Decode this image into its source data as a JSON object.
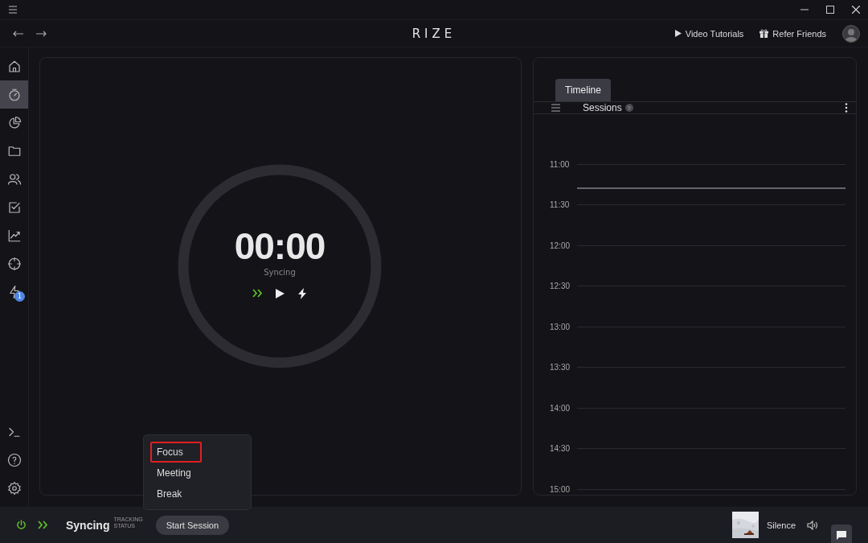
{
  "app": {
    "title": "RIZE"
  },
  "header_links": [
    {
      "kind": "play",
      "label": "Video Tutorials"
    },
    {
      "kind": "gift",
      "label": "Refer Friends"
    }
  ],
  "sidebar": {
    "items": [
      {
        "kind": "home",
        "selected": false
      },
      {
        "kind": "timer",
        "selected": true
      },
      {
        "kind": "pie",
        "selected": false
      },
      {
        "kind": "folder",
        "selected": false
      },
      {
        "kind": "people",
        "selected": false
      },
      {
        "kind": "check",
        "selected": false
      },
      {
        "kind": "chart",
        "selected": false
      },
      {
        "kind": "target",
        "selected": false
      },
      {
        "kind": "bolt",
        "selected": false,
        "badge": "1"
      }
    ],
    "bottom_items": [
      {
        "kind": "terminal"
      },
      {
        "kind": "help"
      },
      {
        "kind": "settings"
      }
    ]
  },
  "timer": {
    "time": "00:00",
    "status": "Syncing"
  },
  "timeline": {
    "tabs": [
      {
        "label": "Timeline",
        "selected": true
      }
    ],
    "title": "Sessions",
    "help": "?",
    "times": [
      "11:00",
      "11:30",
      "12:00",
      "12:30",
      "13:00",
      "13:30",
      "14:00",
      "14:30",
      "15:00"
    ]
  },
  "session_menu": {
    "items": [
      {
        "label": "Focus",
        "selected": true
      },
      {
        "label": "Meeting",
        "selected": false
      },
      {
        "label": "Break",
        "selected": false
      }
    ]
  },
  "status_bar": {
    "tracking": "Syncing",
    "tracking_caption": [
      "TRACKING",
      "STATUS"
    ],
    "button": "Start Session",
    "sound": "Silence"
  }
}
